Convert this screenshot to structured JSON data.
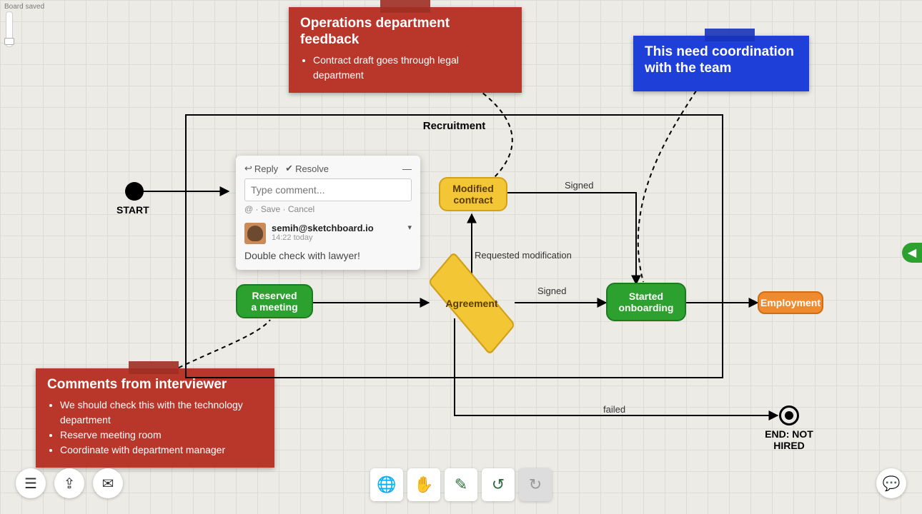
{
  "status_text": "Board saved",
  "notes": {
    "ops": {
      "title": "Operations department feedback",
      "items": [
        "Contract draft goes through legal department"
      ]
    },
    "coord": {
      "title": "This need coordination with the team"
    },
    "interviewer": {
      "title": "Comments from interviewer",
      "items": [
        "We should check this with the technology department",
        "Reserve meeting room",
        "Coordinate with department manager"
      ]
    }
  },
  "frame": {
    "title": "Recruitment"
  },
  "nodes": {
    "start_label": "START",
    "reserved": "Reserved\na meeting",
    "agreement": "Agreement",
    "modified": "Modified\ncontract",
    "onboarding": "Started\nonboarding",
    "employment": "Employment",
    "end_label": "END: NOT HIRED"
  },
  "edges": {
    "signed_top": "Signed",
    "requested": "Requested modification",
    "signed_mid": "Signed",
    "failed": "failed"
  },
  "comment": {
    "reply": "Reply",
    "resolve": "Resolve",
    "minimize": "—",
    "placeholder": "Type comment...",
    "hints": "@ · Save · Cancel",
    "user": "semih@sketchboard.io",
    "time": "14:22 today",
    "body": "Double check with lawyer!"
  },
  "icons": {
    "globe": "globe-icon",
    "hand": "hand-icon",
    "pencil": "pencil-icon",
    "undo": "undo-icon",
    "redo": "redo-icon",
    "list": "list-icon",
    "share": "share-icon",
    "chat": "chat-icon",
    "comment_bubble": "comment-bubble-icon",
    "side_arrow": "collapse-arrow-icon"
  }
}
